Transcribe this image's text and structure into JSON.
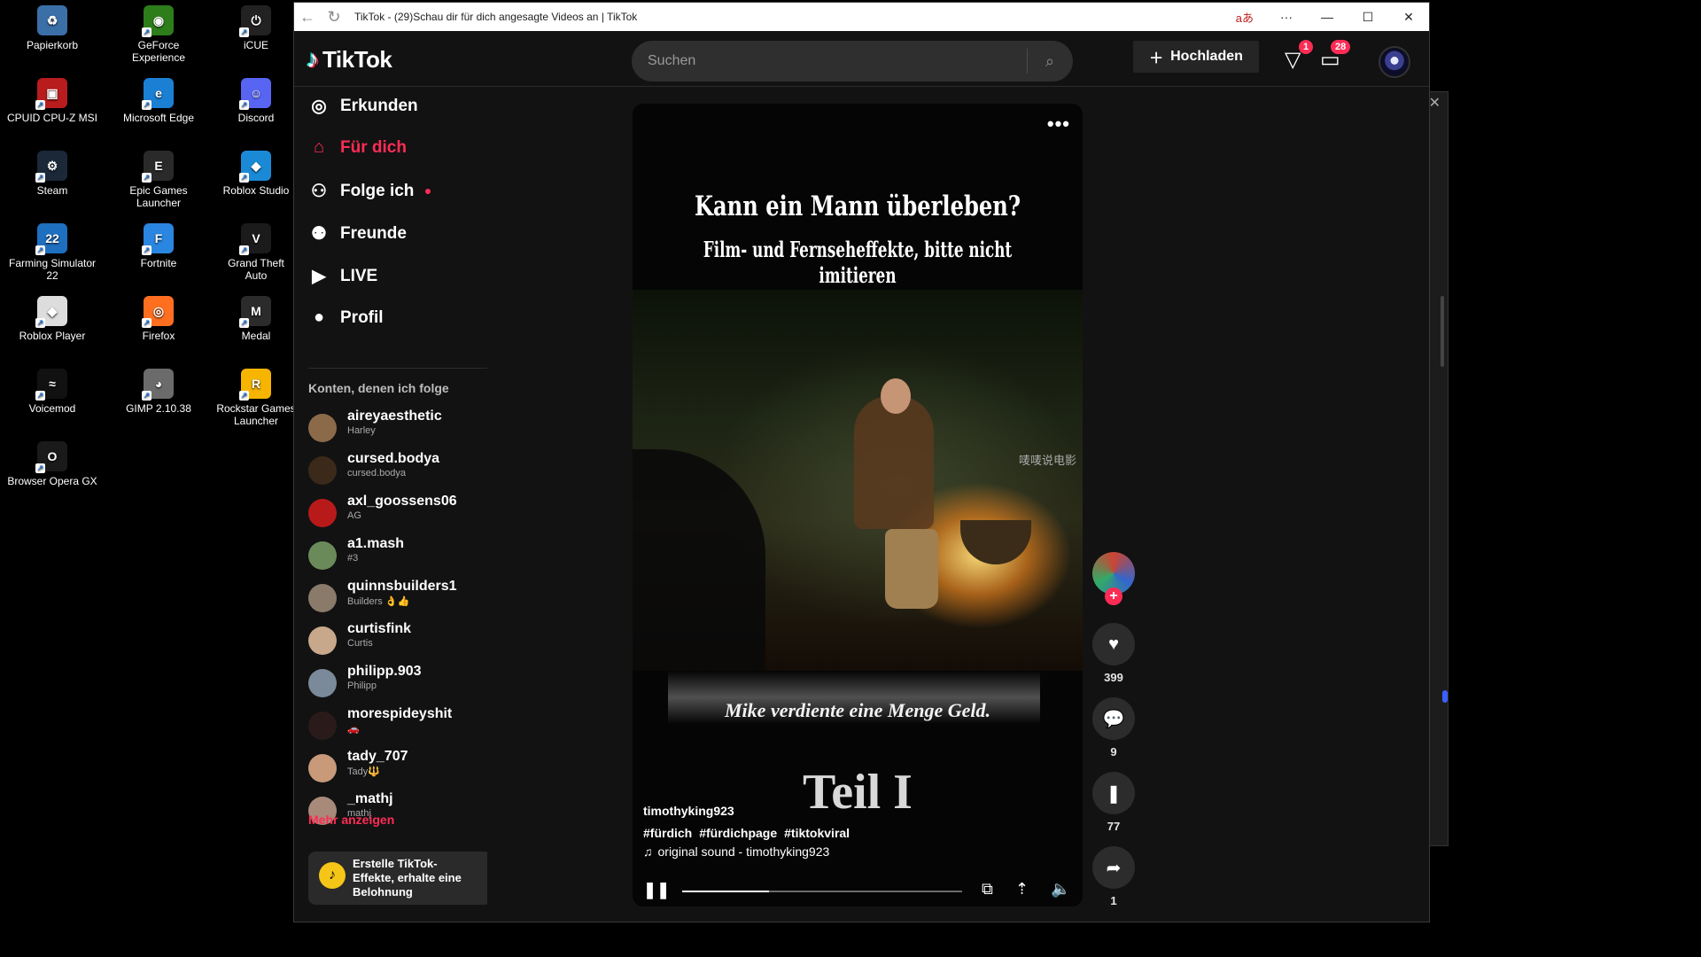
{
  "desktop": {
    "icons": [
      {
        "label": "Papierkorb",
        "color": "#3b6fa8",
        "glyph": "♻"
      },
      {
        "label": "GeForce Experience",
        "color": "#2d7d1a",
        "glyph": "◉"
      },
      {
        "label": "iCUE",
        "color": "#222222",
        "glyph": "⏻"
      },
      {
        "label": "CPUID CPU-Z MSI",
        "color": "#b81c1c",
        "glyph": "▣"
      },
      {
        "label": "Microsoft Edge",
        "color": "#1b7fd4",
        "glyph": "e"
      },
      {
        "label": "Discord",
        "color": "#5865f2",
        "glyph": "☺"
      },
      {
        "label": "Steam",
        "color": "#1b2838",
        "glyph": "⚙"
      },
      {
        "label": "Epic Games Launcher",
        "color": "#2a2a2a",
        "glyph": "E"
      },
      {
        "label": "Roblox Studio",
        "color": "#1a8ad6",
        "glyph": "◆"
      },
      {
        "label": "Farming Simulator 22",
        "color": "#1e6fc0",
        "glyph": "22"
      },
      {
        "label": "Fortnite",
        "color": "#2a86e0",
        "glyph": "F"
      },
      {
        "label": "Grand Theft Auto",
        "color": "#1b1b1b",
        "glyph": "V"
      },
      {
        "label": "Roblox Player",
        "color": "#dddddd",
        "glyph": "◆"
      },
      {
        "label": "Firefox",
        "color": "#ff6f1f",
        "glyph": "◎"
      },
      {
        "label": "Medal",
        "color": "#2b2b2b",
        "glyph": "M"
      },
      {
        "label": "Voicemod",
        "color": "#111111",
        "glyph": "≈"
      },
      {
        "label": "GIMP 2.10.38",
        "color": "#6b6b6b",
        "glyph": "◕"
      },
      {
        "label": "Rockstar Games Launcher",
        "color": "#f7b500",
        "glyph": "R"
      },
      {
        "label": "Browser Opera GX",
        "color": "#1a1a1a",
        "glyph": "O"
      }
    ]
  },
  "browser": {
    "title": "TikTok - (29)Schau dir für dich angesagte Videos an | TikTok",
    "translate_label": "aあ",
    "more_label": "···",
    "minimize_label": "—",
    "maximize_label": "☐",
    "close_label": "✕",
    "back_label": "←",
    "reload_label": "↻"
  },
  "header": {
    "logo_text": "TikTok",
    "search_placeholder": "Suchen",
    "upload_label": "Hochladen",
    "inbox_badge": "1",
    "messages_badge": "28"
  },
  "sidebar": {
    "nav": [
      {
        "label": "Erkunden",
        "icon": "compass-icon",
        "glyph": "◎"
      },
      {
        "label": "Für dich",
        "icon": "home-icon",
        "glyph": "⌂"
      },
      {
        "label": "Folge ich",
        "icon": "following-icon",
        "glyph": "⚇"
      },
      {
        "label": "Freunde",
        "icon": "friends-icon",
        "glyph": "⚉"
      },
      {
        "label": "LIVE",
        "icon": "live-icon",
        "glyph": "▶"
      },
      {
        "label": "Profil",
        "icon": "profile-icon",
        "glyph": "●"
      }
    ],
    "following_heading": "Konten, denen ich folge",
    "accounts": [
      {
        "user": "aireyaesthetic",
        "name": "Harley",
        "color": "#8b6a4a"
      },
      {
        "user": "cursed.bodya",
        "name": "cursed.bodya",
        "color": "#3b2a1a"
      },
      {
        "user": "axl_goossens06",
        "name": "AG",
        "color": "#b81a1a"
      },
      {
        "user": "a1.mash",
        "name": "#3",
        "color": "#6a8a5a"
      },
      {
        "user": "quinnsbuilders1",
        "name": "Builders 👌👍",
        "color": "#8a7a6a"
      },
      {
        "user": "curtisfink",
        "name": "Curtis",
        "color": "#c8a88a"
      },
      {
        "user": "philipp.903",
        "name": "Philipp",
        "color": "#7a8a9a"
      },
      {
        "user": "morespideyshit",
        "name": "🚗",
        "color": "#2a1a1a"
      },
      {
        "user": "tady_707",
        "name": "Tady🔱",
        "color": "#c89a7a"
      },
      {
        "user": "_mathj",
        "name": "mathj",
        "color": "#a88a7a"
      }
    ],
    "more_label": "Mehr anzeigen",
    "promo_text": "Erstelle TikTok-Effekte, erhalte eine Belohnung"
  },
  "video": {
    "title_line1": "Kann ein Mann überleben?",
    "title_line2": "Film- und Fernseheffekte, bitte nicht imitieren",
    "subtitle": "Mike verdiente eine Menge Geld.",
    "part": "Teil I",
    "watermark": "唛唛说电影",
    "username": "timothyking923",
    "hashtags": [
      "#fürdich",
      "#fürdichpage",
      "#tiktokviral"
    ],
    "sound": "original sound - timothyking923",
    "progress": 0.31,
    "more_label": "•••"
  },
  "actions": {
    "likes": "399",
    "comments": "9",
    "saves": "77",
    "shares": "1"
  }
}
